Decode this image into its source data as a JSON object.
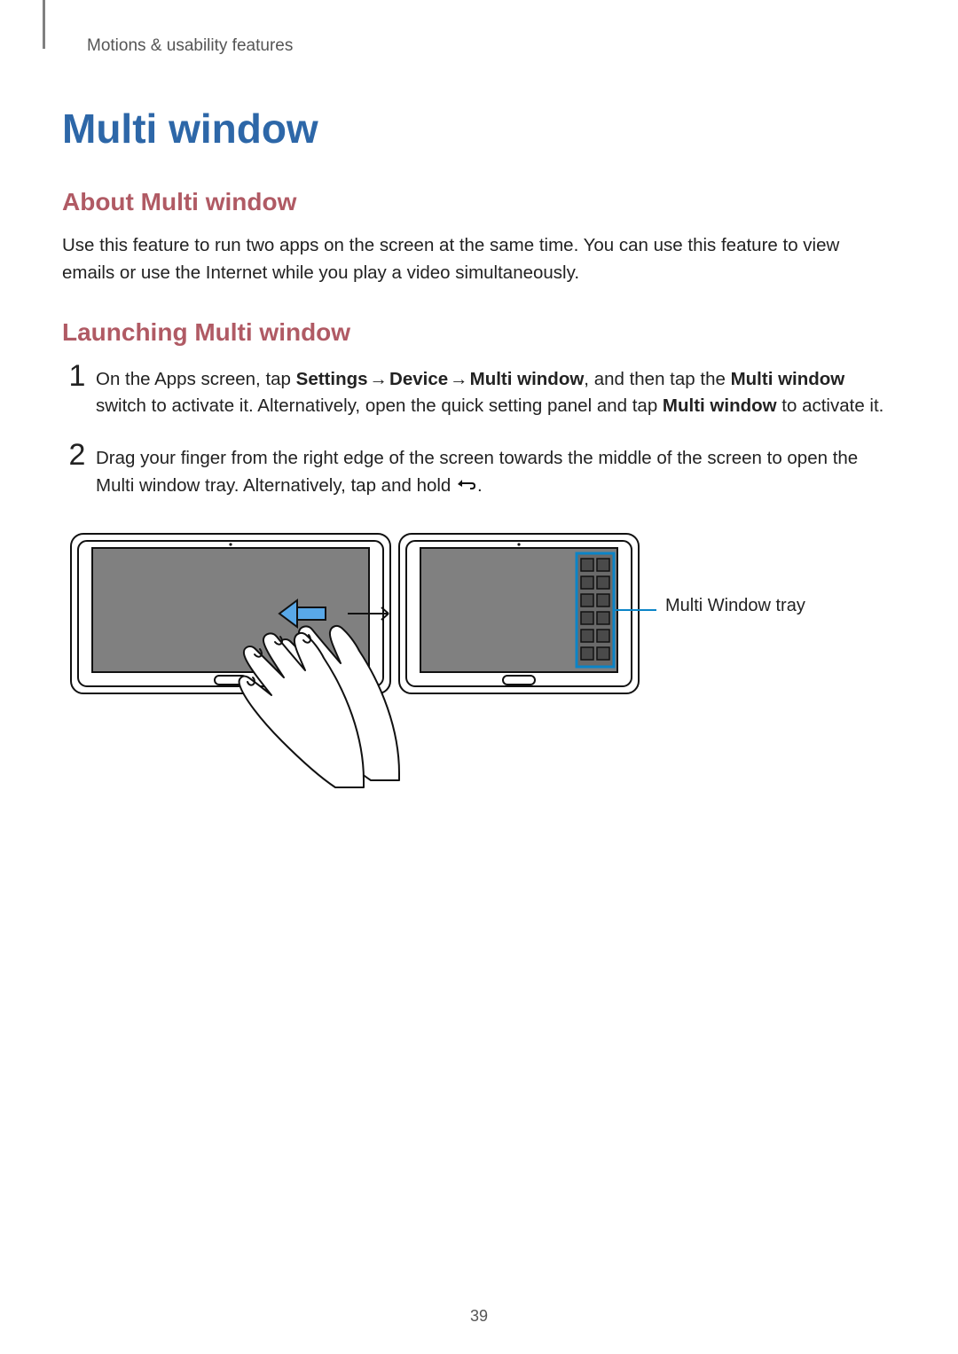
{
  "breadcrumb": "Motions & usability features",
  "h1": "Multi window",
  "about": {
    "heading": "About Multi window",
    "para": "Use this feature to run two apps on the screen at the same time. You can use this feature to view emails or use the Internet while you play a video simultaneously."
  },
  "launch": {
    "heading": "Launching Multi window",
    "steps": [
      {
        "num": "1",
        "pre": "On the Apps screen, tap ",
        "b1": "Settings",
        "arr1": " → ",
        "b2": "Device",
        "arr2": " → ",
        "b3": "Multi window",
        "mid1": ", and then tap the ",
        "b4": "Multi window",
        "mid2": " switch to activate it. Alternatively, open the quick setting panel and tap ",
        "b5": "Multi window",
        "end": " to activate it."
      },
      {
        "num": "2",
        "pre": "Drag your finger from the right edge of the screen towards the middle of the screen to open the Multi window tray. Alternatively, tap and hold ",
        "end": "."
      }
    ]
  },
  "callout": "Multi Window tray",
  "pageNumber": "39"
}
